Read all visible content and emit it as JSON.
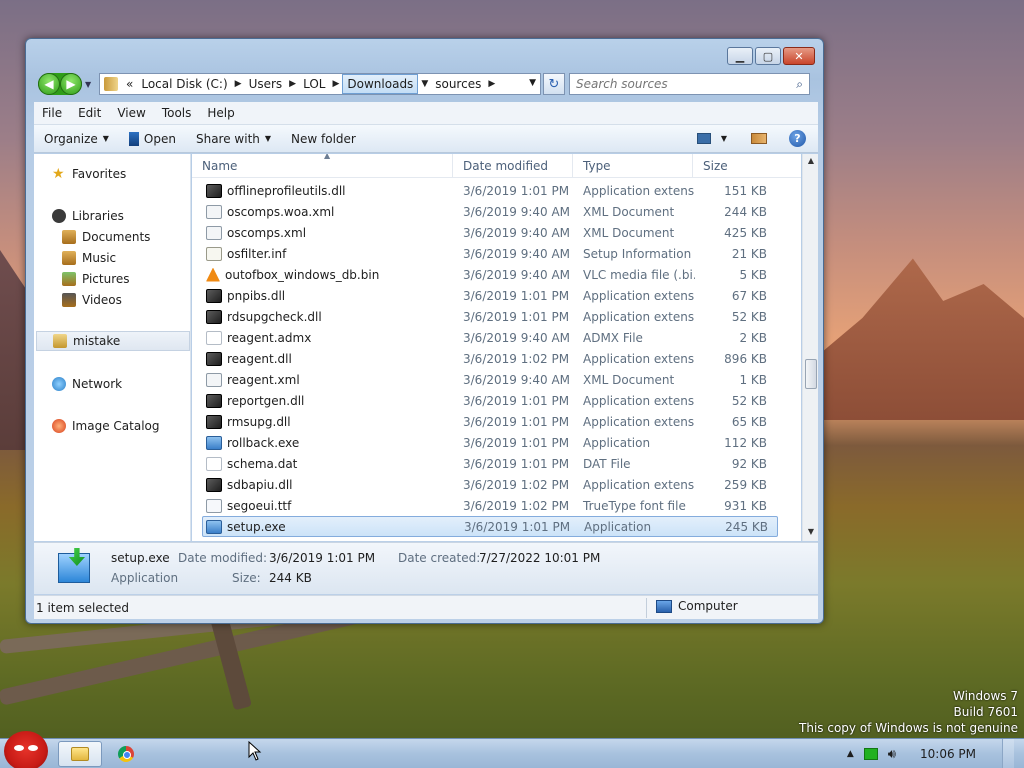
{
  "window": {
    "address": {
      "overflow": "«",
      "crumbs": [
        "Local Disk (C:)",
        "Users",
        "LOL",
        "Downloads",
        "sources"
      ]
    },
    "search_placeholder": "Search sources",
    "menu": [
      "File",
      "Edit",
      "View",
      "Tools",
      "Help"
    ],
    "toolbar": {
      "organize": "Organize",
      "open": "Open",
      "share": "Share with",
      "new_folder": "New folder"
    },
    "nav": {
      "favorites": "Favorites",
      "libraries": "Libraries",
      "documents": "Documents",
      "music": "Music",
      "pictures": "Pictures",
      "videos": "Videos",
      "user": "mistake",
      "network": "Network",
      "image_catalog": "Image Catalog"
    },
    "columns": [
      "Name",
      "Date modified",
      "Type",
      "Size"
    ],
    "files": [
      {
        "name": "offlineprofileutils.dll",
        "date": "3/6/2019 1:01 PM",
        "type": "Application extens...",
        "size": "151 KB",
        "icon": "dll"
      },
      {
        "name": "oscomps.woa.xml",
        "date": "3/6/2019 9:40 AM",
        "type": "XML Document",
        "size": "244 KB",
        "icon": "xml"
      },
      {
        "name": "oscomps.xml",
        "date": "3/6/2019 9:40 AM",
        "type": "XML Document",
        "size": "425 KB",
        "icon": "xml"
      },
      {
        "name": "osfilter.inf",
        "date": "3/6/2019 9:40 AM",
        "type": "Setup Information",
        "size": "21 KB",
        "icon": "inf"
      },
      {
        "name": "outofbox_windows_db.bin",
        "date": "3/6/2019 9:40 AM",
        "type": "VLC media file (.bi...",
        "size": "5 KB",
        "icon": "vlc"
      },
      {
        "name": "pnpibs.dll",
        "date": "3/6/2019 1:01 PM",
        "type": "Application extens...",
        "size": "67 KB",
        "icon": "dll"
      },
      {
        "name": "rdsupgcheck.dll",
        "date": "3/6/2019 1:01 PM",
        "type": "Application extens...",
        "size": "52 KB",
        "icon": "dll"
      },
      {
        "name": "reagent.admx",
        "date": "3/6/2019 9:40 AM",
        "type": "ADMX File",
        "size": "2 KB",
        "icon": "file"
      },
      {
        "name": "reagent.dll",
        "date": "3/6/2019 1:02 PM",
        "type": "Application extens...",
        "size": "896 KB",
        "icon": "dll"
      },
      {
        "name": "reagent.xml",
        "date": "3/6/2019 9:40 AM",
        "type": "XML Document",
        "size": "1 KB",
        "icon": "xml"
      },
      {
        "name": "reportgen.dll",
        "date": "3/6/2019 1:01 PM",
        "type": "Application extens...",
        "size": "52 KB",
        "icon": "dll"
      },
      {
        "name": "rmsupg.dll",
        "date": "3/6/2019 1:01 PM",
        "type": "Application extens...",
        "size": "65 KB",
        "icon": "dll"
      },
      {
        "name": "rollback.exe",
        "date": "3/6/2019 1:01 PM",
        "type": "Application",
        "size": "112 KB",
        "icon": "exe"
      },
      {
        "name": "schema.dat",
        "date": "3/6/2019 1:01 PM",
        "type": "DAT File",
        "size": "92 KB",
        "icon": "file"
      },
      {
        "name": "sdbapiu.dll",
        "date": "3/6/2019 1:02 PM",
        "type": "Application extens...",
        "size": "259 KB",
        "icon": "dll"
      },
      {
        "name": "segoeui.ttf",
        "date": "3/6/2019 1:02 PM",
        "type": "TrueType font file",
        "size": "931 KB",
        "icon": "font"
      },
      {
        "name": "setup.exe",
        "date": "3/6/2019 1:01 PM",
        "type": "Application",
        "size": "245 KB",
        "icon": "exe",
        "selected": true
      }
    ],
    "details": {
      "name": "setup.exe",
      "type": "Application",
      "modified_label": "Date modified:",
      "modified_value": "3/6/2019 1:01 PM",
      "created_label": "Date created:",
      "created_value": "7/27/2022 10:01 PM",
      "size_label": "Size:",
      "size_value": "244 KB"
    },
    "status": {
      "selection": "1 item selected",
      "location": "Computer"
    }
  },
  "watermark": {
    "line1": "Windows 7",
    "line2": "Build 7601",
    "line3": "This copy of Windows is not genuine"
  },
  "taskbar": {
    "clock": "10:06 PM"
  }
}
